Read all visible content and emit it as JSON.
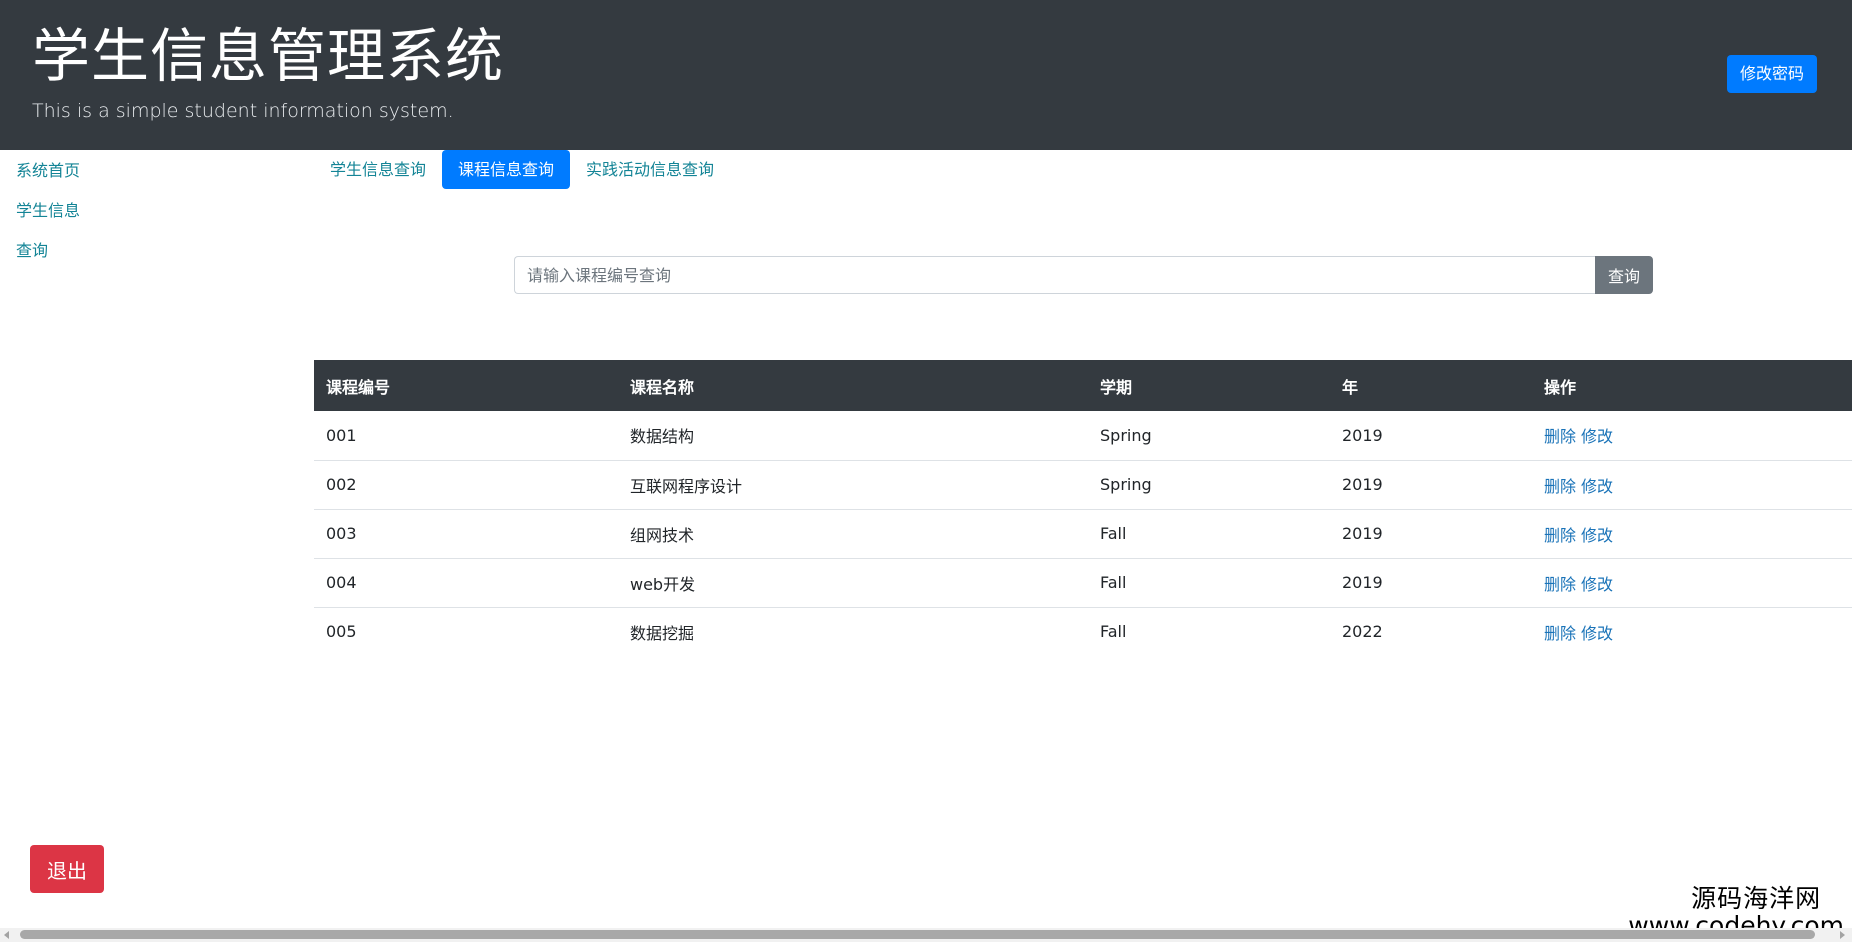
{
  "header": {
    "title": "学生信息管理系统",
    "subtitle": "This is a simple student information system.",
    "change_password_label": "修改密码"
  },
  "sidebar": {
    "items": [
      {
        "label": "系统首页"
      },
      {
        "label": "学生信息"
      },
      {
        "label": "查询"
      }
    ]
  },
  "tabs": [
    {
      "label": "学生信息查询",
      "active": false
    },
    {
      "label": "课程信息查询",
      "active": true
    },
    {
      "label": "实践活动信息查询",
      "active": false
    }
  ],
  "search": {
    "placeholder": "请输入课程编号查询",
    "value": "",
    "button_label": "查询"
  },
  "table": {
    "columns": [
      "课程编号",
      "课程名称",
      "学期",
      "年",
      "操作"
    ],
    "rows": [
      {
        "id": "001",
        "name": "数据结构",
        "term": "Spring",
        "year": "2019"
      },
      {
        "id": "002",
        "name": "互联网程序设计",
        "term": "Spring",
        "year": "2019"
      },
      {
        "id": "003",
        "name": "组网技术",
        "term": "Fall",
        "year": "2019"
      },
      {
        "id": "004",
        "name": "web开发",
        "term": "Fall",
        "year": "2019"
      },
      {
        "id": "005",
        "name": "数据挖掘",
        "term": "Fall",
        "year": "2022"
      }
    ],
    "actions": {
      "delete_label": "删除",
      "edit_label": "修改"
    }
  },
  "logout_label": "退出",
  "watermark": {
    "line1": "源码海洋网",
    "line2": "www.codehy.com"
  },
  "colors": {
    "header_bg": "#343a40",
    "primary": "#007bff",
    "secondary": "#6c757d",
    "danger": "#dc3545",
    "link": "#138496"
  }
}
